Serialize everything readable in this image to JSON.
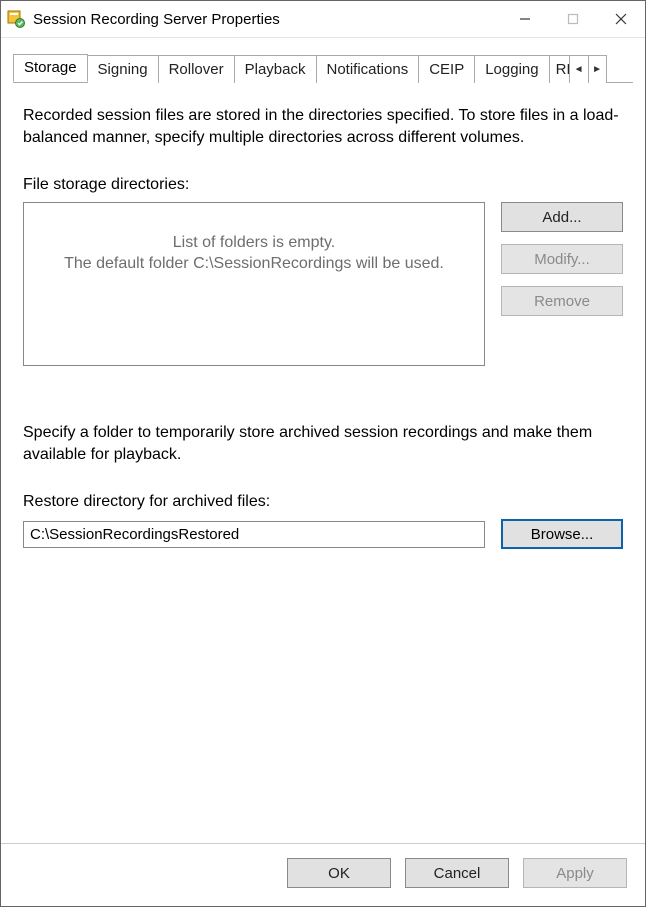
{
  "window": {
    "title": "Session Recording Server Properties"
  },
  "tabs": {
    "items": [
      "Storage",
      "Signing",
      "Rollover",
      "Playback",
      "Notifications",
      "CEIP",
      "Logging",
      "RBAC"
    ],
    "active_index": 0
  },
  "storage": {
    "description": "Recorded session files are stored in the directories specified. To store files in a load-balanced manner, specify multiple directories across different volumes.",
    "dir_label": "File storage directories:",
    "empty_line1": "List of folders is empty.",
    "empty_line2": "The default folder C:\\SessionRecordings will be used.",
    "buttons": {
      "add": "Add...",
      "modify": "Modify...",
      "remove": "Remove"
    },
    "restore_desc": "Specify a folder to temporarily store archived session recordings and make them available for playback.",
    "restore_label": "Restore directory for archived files:",
    "restore_value": "C:\\SessionRecordingsRestored",
    "browse": "Browse..."
  },
  "footer": {
    "ok": "OK",
    "cancel": "Cancel",
    "apply": "Apply"
  }
}
